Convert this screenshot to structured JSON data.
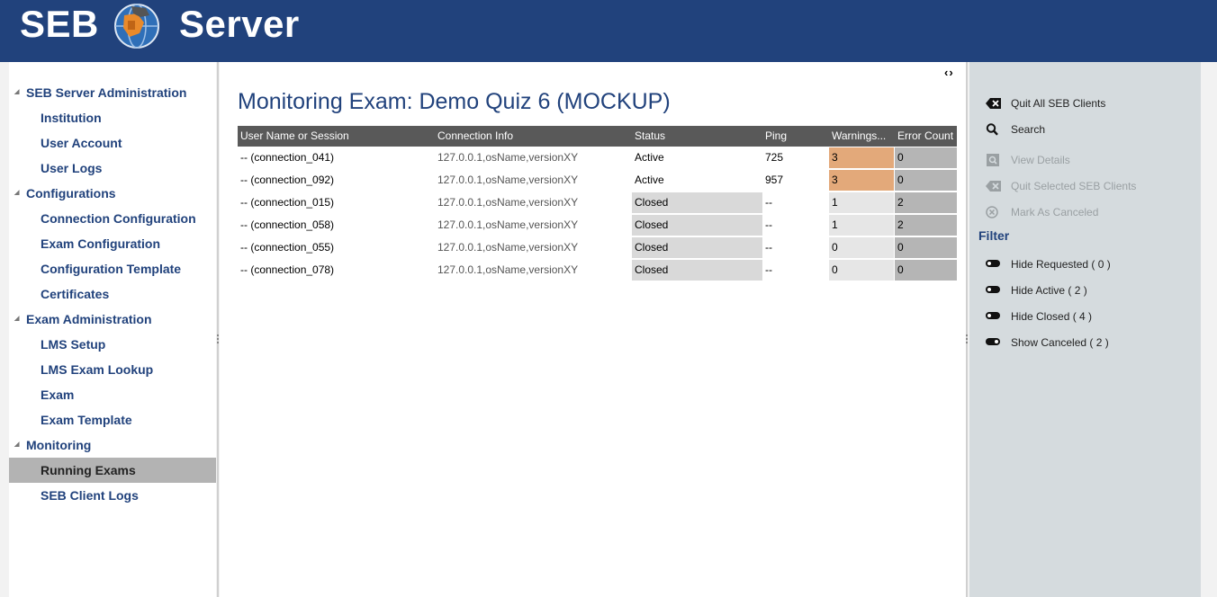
{
  "app": {
    "logo_left": "SEB",
    "logo_right": "Server",
    "brand_color": "#21427c"
  },
  "nav": {
    "groups": [
      {
        "label": "SEB Server Administration",
        "items": [
          "Institution",
          "User Account",
          "User Logs"
        ]
      },
      {
        "label": "Configurations",
        "items": [
          "Connection Configuration",
          "Exam Configuration",
          "Configuration Template",
          "Certificates"
        ]
      },
      {
        "label": "Exam Administration",
        "items": [
          "LMS Setup",
          "LMS Exam Lookup",
          "Exam",
          "Exam Template"
        ]
      },
      {
        "label": "Monitoring",
        "items": [
          "Running Exams",
          "SEB Client Logs"
        ]
      }
    ],
    "selected": "Running Exams"
  },
  "main": {
    "collapse_toggle": "‹›",
    "title": "Monitoring Exam: Demo Quiz 6 (MOCKUP)",
    "table": {
      "columns": [
        "User Name or Session",
        "Connection Info",
        "Status",
        "Ping",
        "Warnings...",
        "Error Count"
      ],
      "rows": [
        {
          "session": "-- (connection_041)",
          "info": "127.0.0.1,osName,versionXY",
          "status": "Active",
          "ping": "725",
          "warnings": "3",
          "errors": "0"
        },
        {
          "session": "-- (connection_092)",
          "info": "127.0.0.1,osName,versionXY",
          "status": "Active",
          "ping": "957",
          "warnings": "3",
          "errors": "0"
        },
        {
          "session": "-- (connection_015)",
          "info": "127.0.0.1,osName,versionXY",
          "status": "Closed",
          "ping": "--",
          "warnings": "1",
          "errors": "2"
        },
        {
          "session": "-- (connection_058)",
          "info": "127.0.0.1,osName,versionXY",
          "status": "Closed",
          "ping": "--",
          "warnings": "1",
          "errors": "2"
        },
        {
          "session": "-- (connection_055)",
          "info": "127.0.0.1,osName,versionXY",
          "status": "Closed",
          "ping": "--",
          "warnings": "0",
          "errors": "0"
        },
        {
          "session": "-- (connection_078)",
          "info": "127.0.0.1,osName,versionXY",
          "status": "Closed",
          "ping": "--",
          "warnings": "0",
          "errors": "0"
        }
      ]
    }
  },
  "actions": {
    "items": [
      {
        "label": "Quit All SEB Clients",
        "icon": "quit-icon",
        "enabled": true
      },
      {
        "label": "Search",
        "icon": "search-icon",
        "enabled": true
      },
      {
        "label": "View Details",
        "icon": "view-details-icon",
        "enabled": false
      },
      {
        "label": "Quit Selected SEB Clients",
        "icon": "quit-icon",
        "enabled": false
      },
      {
        "label": "Mark As Canceled",
        "icon": "cancel-circle-icon",
        "enabled": false
      }
    ],
    "filter_title": "Filter",
    "filters": [
      {
        "label": "Hide Requested ( 0 )",
        "icon": "toggle-off-icon"
      },
      {
        "label": "Hide Active ( 2 )",
        "icon": "toggle-off-icon"
      },
      {
        "label": "Hide Closed ( 4 )",
        "icon": "toggle-off-icon"
      },
      {
        "label": "Show Canceled ( 2 )",
        "icon": "toggle-on-icon"
      }
    ]
  }
}
